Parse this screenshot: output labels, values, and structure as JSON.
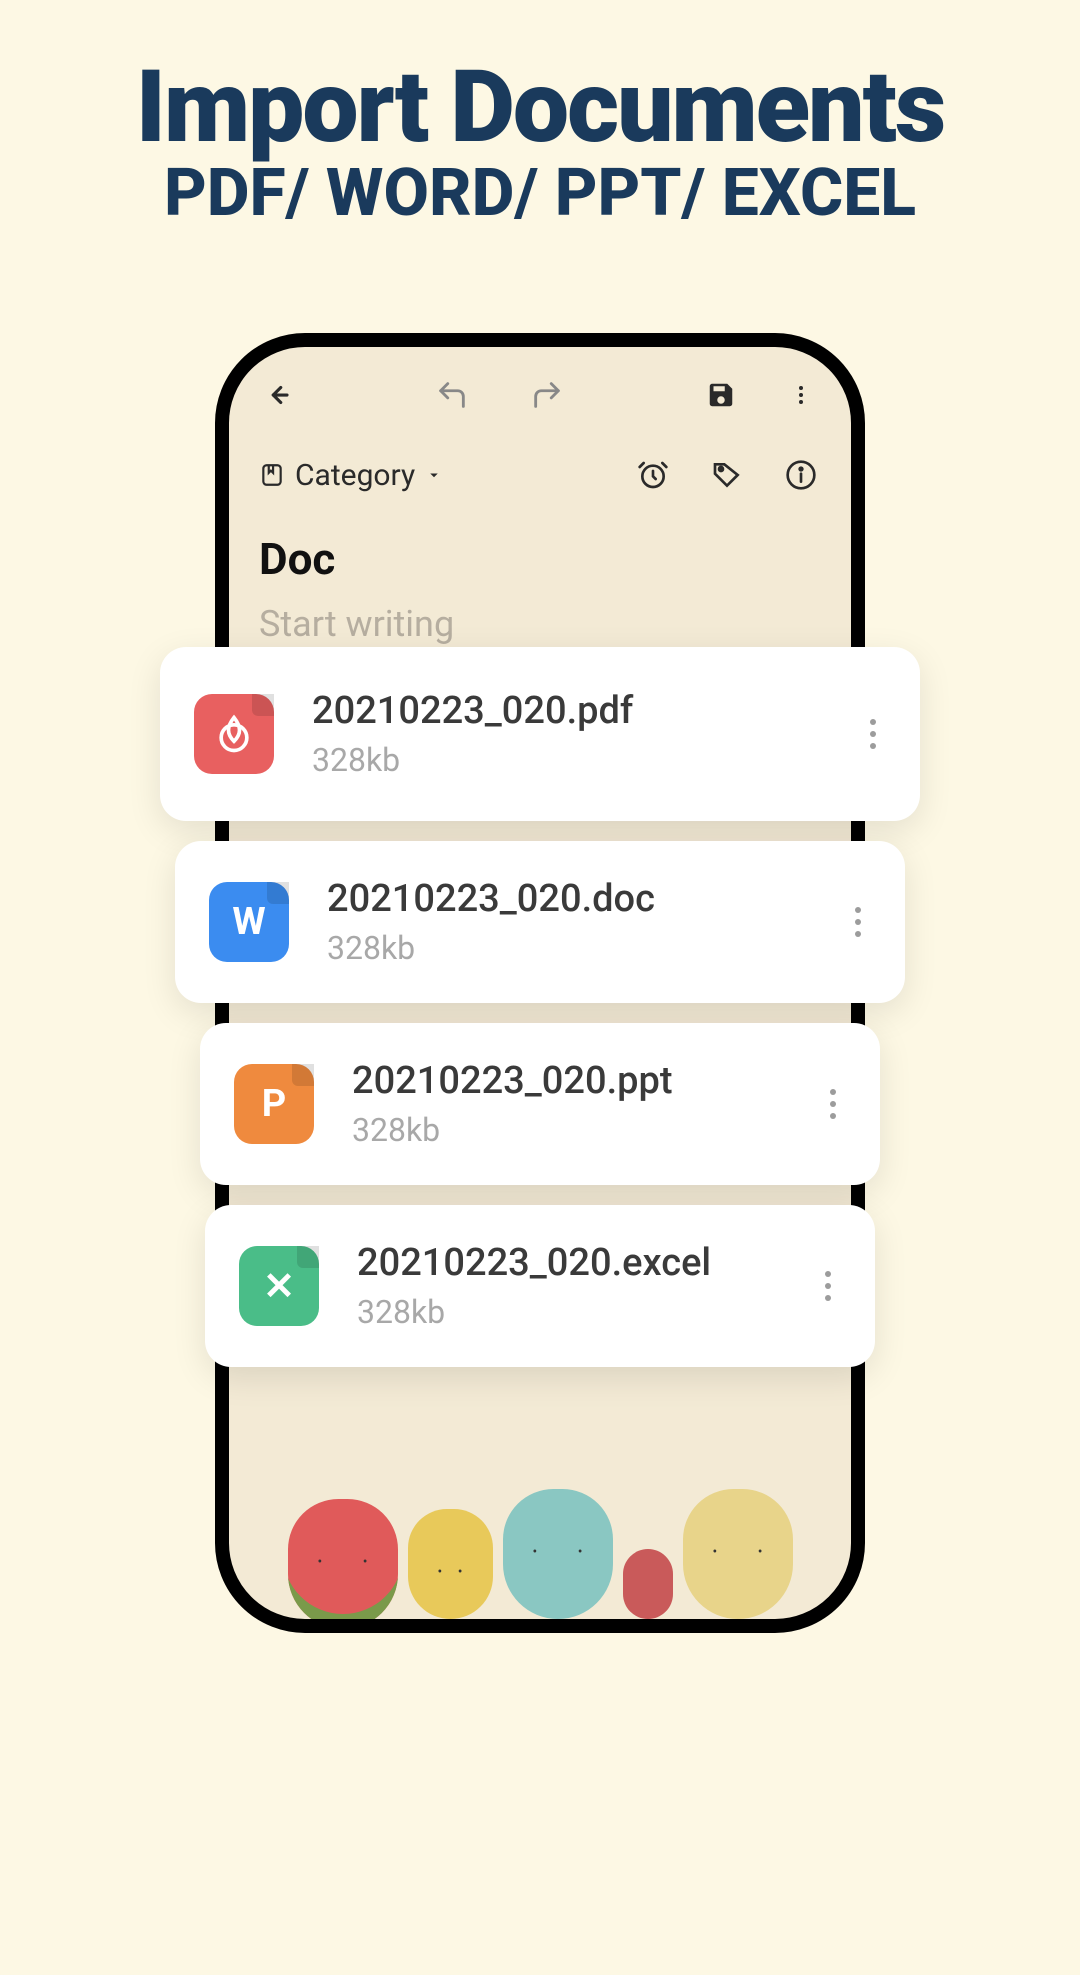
{
  "hero": {
    "title": "Import Documents",
    "subtitle": "PDF/ WORD/ PPT/ EXCEL"
  },
  "category": {
    "label": "Category"
  },
  "note": {
    "title": "Doc",
    "placeholder": "Start writing"
  },
  "files": [
    {
      "name": "20210223_020.pdf",
      "size": "328kb",
      "type": "pdf",
      "letter": ""
    },
    {
      "name": "20210223_020.doc",
      "size": "328kb",
      "type": "doc",
      "letter": "W"
    },
    {
      "name": "20210223_020.ppt",
      "size": "328kb",
      "type": "ppt",
      "letter": "P"
    },
    {
      "name": "20210223_020.excel",
      "size": "328kb",
      "type": "excel",
      "letter": "✕"
    }
  ]
}
